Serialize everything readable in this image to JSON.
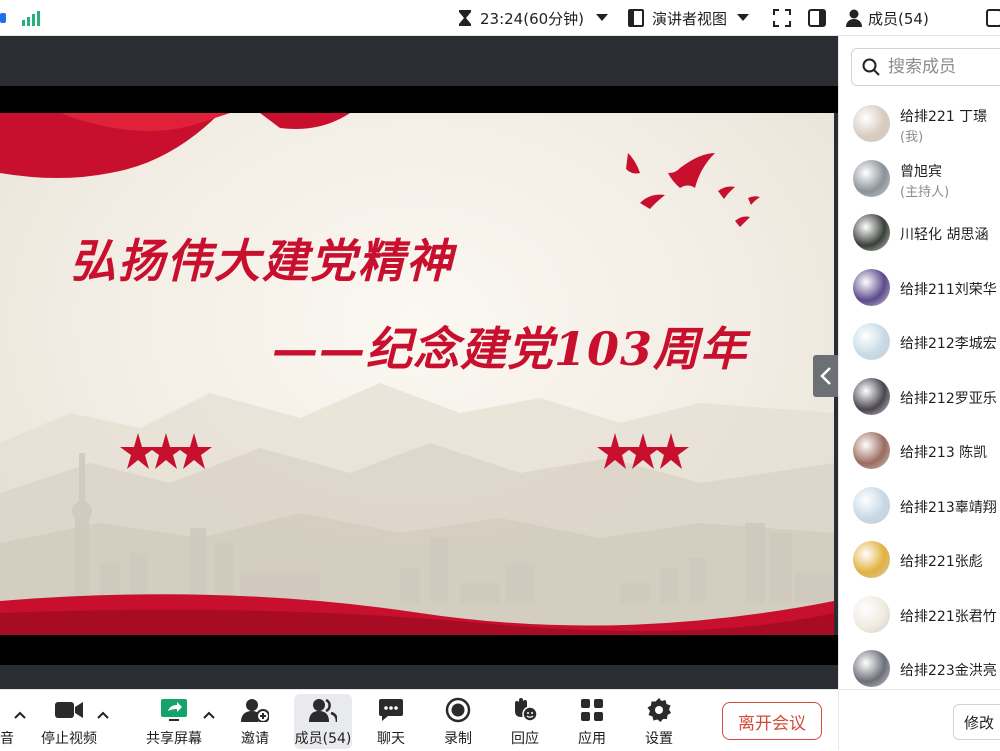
{
  "topbar": {
    "timer": "23:24(60分钟)",
    "view_mode": "演讲者视图",
    "members_title": "成员(54)"
  },
  "slide": {
    "title_line1": "弘扬伟大建党精神",
    "title_line2": "——纪念建党103周年"
  },
  "members_panel": {
    "search_placeholder": "搜索成员",
    "members": [
      {
        "name": "给排221 丁璟",
        "tag": "(我)",
        "avatar_color": "#d9cbbf"
      },
      {
        "name": "曾旭宾",
        "tag": "(主持人)",
        "avatar_color": "#8a9299"
      },
      {
        "name": "川轻化 胡思涵",
        "avatar_color": "#3a3f3a"
      },
      {
        "name": "给排211刘荣华",
        "avatar_color": "#5b4a8c"
      },
      {
        "name": "给排212李城宏",
        "avatar_color": "#c7dbe6"
      },
      {
        "name": "给排212罗亚乐",
        "avatar_color": "#4a4550"
      },
      {
        "name": "给排213 陈凯",
        "avatar_color": "#9b6a5e"
      },
      {
        "name": "给排213辜靖翔",
        "avatar_color": "#c9d8e6"
      },
      {
        "name": "给排221张彪",
        "avatar_color": "#e2b13c"
      },
      {
        "name": "给排221张君竹",
        "avatar_color": "#f0ebe0"
      },
      {
        "name": "给排223金洪亮",
        "avatar_color": "#6b6f78"
      }
    ]
  },
  "toolbar": {
    "audio_label": "音",
    "video_label": "停止视频",
    "share_label": "共享屏幕",
    "invite_label": "邀请",
    "members_label": "成员(54)",
    "chat_label": "聊天",
    "record_label": "录制",
    "react_label": "回应",
    "apps_label": "应用",
    "settings_label": "设置",
    "leave_label": "离开会议",
    "modify_label": "修改"
  },
  "colors": {
    "accent_red": "#c8102e",
    "leave_red": "#d54a3a",
    "signal_green": "#26b07a",
    "share_green": "#14a36b"
  }
}
